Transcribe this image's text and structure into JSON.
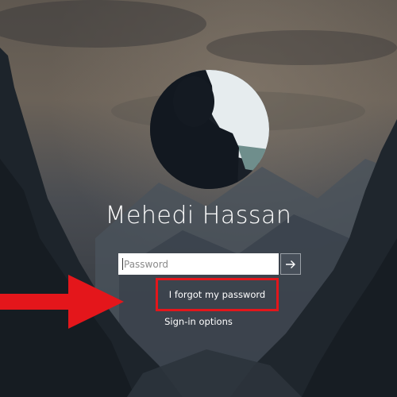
{
  "user": {
    "name": "Mehedi Hassan"
  },
  "password": {
    "placeholder": "Password",
    "value": ""
  },
  "links": {
    "forgot_password": "I forgot my password",
    "signin_options": "Sign-in options"
  },
  "annotation": {
    "color": "#e4161b"
  }
}
